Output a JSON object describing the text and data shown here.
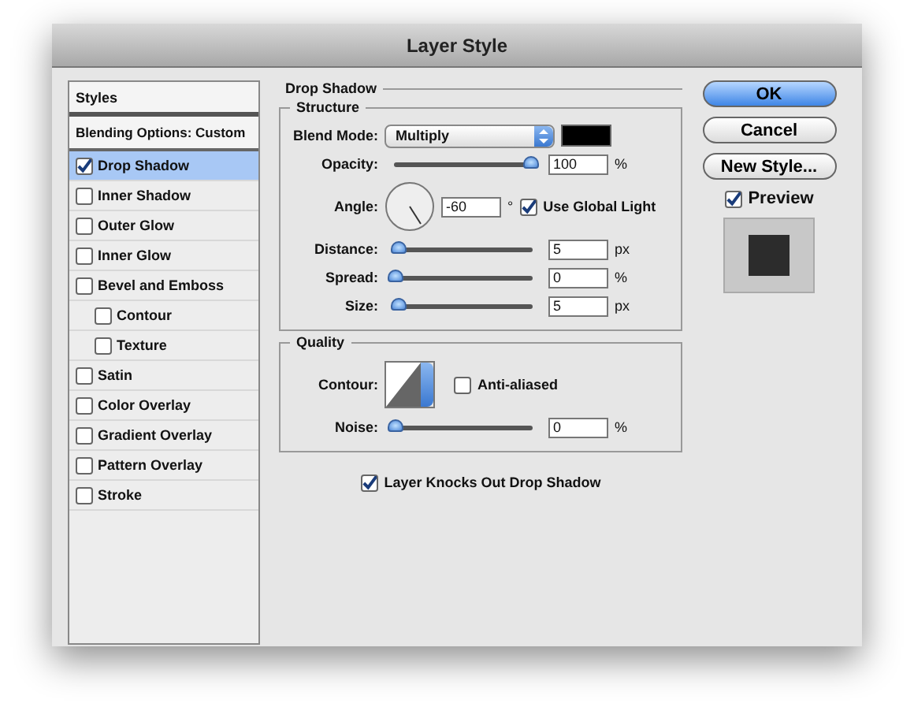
{
  "window": {
    "title": "Layer Style"
  },
  "styles_panel": {
    "header": "Styles",
    "items": [
      {
        "label": "Blending Options: Custom",
        "kind": "plain",
        "selected": false
      },
      {
        "label": "Drop Shadow",
        "kind": "check",
        "checked": true,
        "selected": true
      },
      {
        "label": "Inner Shadow",
        "kind": "check",
        "checked": false,
        "selected": false
      },
      {
        "label": "Outer Glow",
        "kind": "check",
        "checked": false,
        "selected": false
      },
      {
        "label": "Inner Glow",
        "kind": "check",
        "checked": false,
        "selected": false
      },
      {
        "label": "Bevel and Emboss",
        "kind": "check",
        "checked": false,
        "selected": false,
        "children": [
          {
            "label": "Contour",
            "kind": "check",
            "checked": false,
            "selected": false
          },
          {
            "label": "Texture",
            "kind": "check",
            "checked": false,
            "selected": false
          }
        ]
      },
      {
        "label": "Satin",
        "kind": "check",
        "checked": false,
        "selected": false
      },
      {
        "label": "Color Overlay",
        "kind": "check",
        "checked": false,
        "selected": false
      },
      {
        "label": "Gradient Overlay",
        "kind": "check",
        "checked": false,
        "selected": false
      },
      {
        "label": "Pattern Overlay",
        "kind": "check",
        "checked": false,
        "selected": false
      },
      {
        "label": "Stroke",
        "kind": "check",
        "checked": false,
        "selected": false
      }
    ]
  },
  "drop_shadow": {
    "title": "Drop Shadow",
    "structure": {
      "title": "Structure",
      "blend_mode": {
        "label": "Blend Mode:",
        "value": "Multiply",
        "color": "#000000"
      },
      "opacity": {
        "label": "Opacity:",
        "level": 1,
        "value": "100",
        "unit": "%"
      },
      "angle": {
        "label": "Angle:",
        "value": "-60",
        "unit": "°",
        "use_global_light": {
          "label": "Use Global Light",
          "checked": true
        }
      },
      "sliders": [
        {
          "label": "Distance:",
          "level": 0.02,
          "value": "5",
          "unit": "px"
        },
        {
          "label": "Spread:",
          "level": 0,
          "value": "0",
          "unit": "%"
        },
        {
          "label": "Size:",
          "level": 0.02,
          "value": "5",
          "unit": "px"
        }
      ]
    },
    "quality": {
      "title": "Quality",
      "contour_label": "Contour:",
      "anti_aliased": {
        "label": "Anti-aliased",
        "checked": false
      },
      "noise": {
        "label": "Noise:",
        "level": 0,
        "value": "0",
        "unit": "%"
      }
    },
    "knockout": {
      "label": "Layer Knocks Out Drop Shadow",
      "checked": true
    }
  },
  "buttons": [
    {
      "label": "OK",
      "default": true
    },
    {
      "label": "Cancel",
      "default": false
    },
    {
      "label": "New Style...",
      "default": false
    }
  ],
  "preview": {
    "label": "Preview",
    "checked": true
  }
}
